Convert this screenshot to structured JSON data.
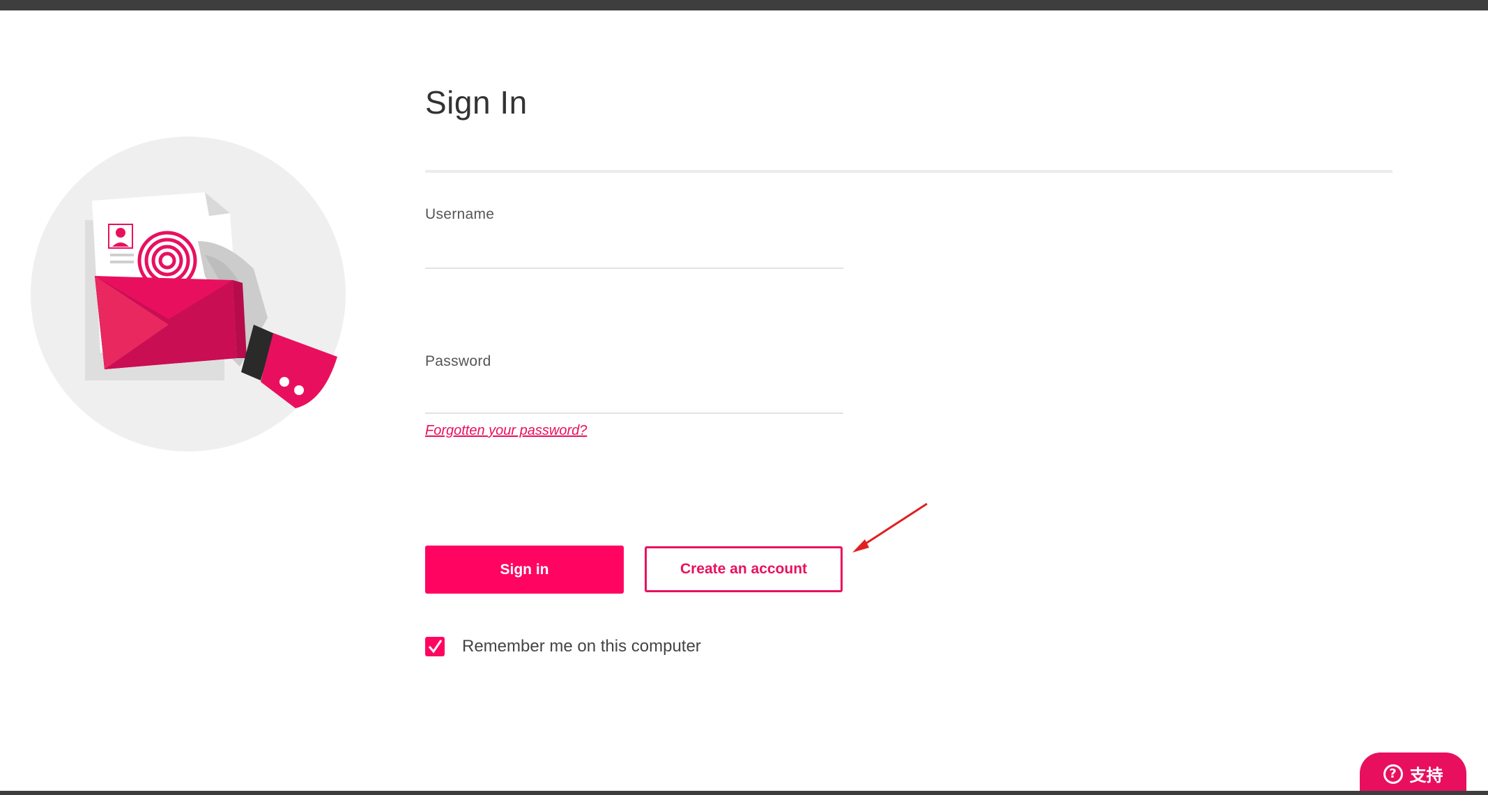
{
  "page": {
    "title": "Sign In"
  },
  "form": {
    "username_label": "Username",
    "username_value": "",
    "password_label": "Password",
    "password_value": "",
    "forgot_link": "Forgotten your password?"
  },
  "actions": {
    "sign_in_label": "Sign in",
    "create_account_label": "Create an account"
  },
  "remember": {
    "label": "Remember me on this computer",
    "checked": true
  },
  "support": {
    "label": "支持",
    "icon": "?"
  },
  "colors": {
    "accent": "#ff0561",
    "accent_dark": "#e8105e",
    "top_bar": "#3e3e3e",
    "illustration_bg": "#efefef",
    "annotation_arrow": "#e02020"
  },
  "icons": {
    "illustration": "envelope-fingerprint-illustration",
    "checkbox": "checkmark-icon",
    "support": "help-circle-icon",
    "annotation": "annotation-arrow"
  }
}
